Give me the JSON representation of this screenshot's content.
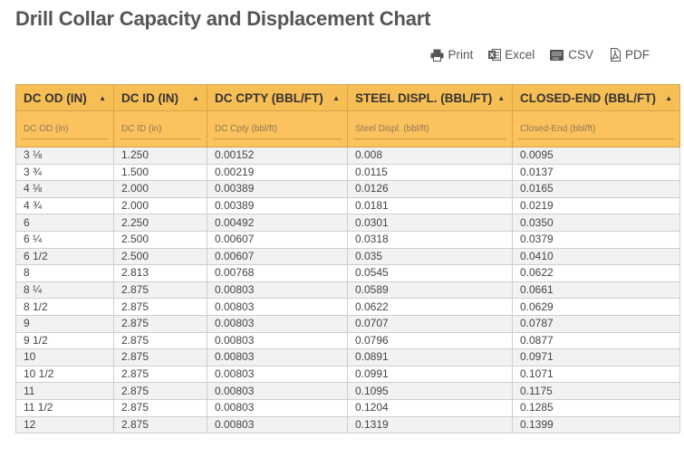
{
  "page": {
    "title": "Drill Collar Capacity and Displacement Chart"
  },
  "export": {
    "print": {
      "label": "Print",
      "icon": "printer-icon"
    },
    "excel": {
      "label": "Excel",
      "icon": "excel-icon"
    },
    "csv": {
      "label": "CSV",
      "icon": "csv-icon"
    },
    "pdf": {
      "label": "PDF",
      "icon": "pdf-icon"
    }
  },
  "table": {
    "header_color": "#f7be55",
    "columns": [
      {
        "label": "DC OD (IN)",
        "filter_placeholder": "DC OD (in)"
      },
      {
        "label": "DC ID (IN)",
        "filter_placeholder": "DC ID (in)"
      },
      {
        "label": "DC CPTY (BBL/FT)",
        "filter_placeholder": "DC Cpty (bbl/ft)"
      },
      {
        "label": "STEEL DISPL. (BBL/FT)",
        "filter_placeholder": "Steel Displ. (bbl/ft)"
      },
      {
        "label": "CLOSED-END (BBL/FT)",
        "filter_placeholder": "Closed-End (bbl/ft)"
      }
    ],
    "rows": [
      [
        "3 ⅛",
        "1.250",
        "0.00152",
        "0.008",
        "0.0095"
      ],
      [
        "3 ¾",
        "1.500",
        "0.00219",
        "0.0115",
        "0.0137"
      ],
      [
        "4 ⅛",
        "2.000",
        "0.00389",
        "0.0126",
        "0.0165"
      ],
      [
        "4 ¾",
        "2.000",
        "0.00389",
        "0.0181",
        "0.0219"
      ],
      [
        "6",
        "2.250",
        "0.00492",
        "0.0301",
        "0.0350"
      ],
      [
        "6 ¼",
        "2.500",
        "0.00607",
        "0.0318",
        "0.0379"
      ],
      [
        "6 1/2",
        "2.500",
        "0.00607",
        "0.035",
        "0.0410"
      ],
      [
        "8",
        "2.813",
        "0.00768",
        "0.0545",
        "0.0622"
      ],
      [
        "8 ¼",
        "2.875",
        "0.00803",
        "0.0589",
        "0.0661"
      ],
      [
        "8 1/2",
        "2.875",
        "0.00803",
        "0.0622",
        "0.0629"
      ],
      [
        "9",
        "2.875",
        "0.00803",
        "0.0707",
        "0.0787"
      ],
      [
        "9 1/2",
        "2.875",
        "0.00803",
        "0.0796",
        "0.0877"
      ],
      [
        "10",
        "2.875",
        "0.00803",
        "0.0891",
        "0.0971"
      ],
      [
        "10 1/2",
        "2.875",
        "0.00803",
        "0.0991",
        "0.1071"
      ],
      [
        "11",
        "2.875",
        "0.00803",
        "0.1095",
        "0.1175"
      ],
      [
        "11 1/2",
        "2.875",
        "0.00803",
        "0.1204",
        "0.1285"
      ],
      [
        "12",
        "2.875",
        "0.00803",
        "0.1319",
        "0.1399"
      ]
    ]
  }
}
